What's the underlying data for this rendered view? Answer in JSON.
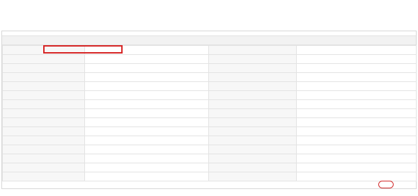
{
  "page": {
    "title": ""
  },
  "serial": {
    "text": ""
  },
  "form": {
    "rows": [
      {
        "left_label": "",
        "left_value": "",
        "right_label": "",
        "right_value": ""
      },
      {
        "left_label": "",
        "left_value": "",
        "right_label": "",
        "right_value": ""
      },
      {
        "left_label": "",
        "left_value": "",
        "right_label": "",
        "right_value": ""
      },
      {
        "left_label": "",
        "left_value": "",
        "right_label": "",
        "right_value": ""
      },
      {
        "left_label": "",
        "left_value": "",
        "right_label": "",
        "right_value": ""
      },
      {
        "left_label": "",
        "left_value": "",
        "right_label": "",
        "right_value": ""
      },
      {
        "left_label": "",
        "left_value": "",
        "right_label": "",
        "right_value": ""
      },
      {
        "left_label": "",
        "left_value": "",
        "right_label": "",
        "right_value": ""
      },
      {
        "left_label": "",
        "left_value": "",
        "right_label": "",
        "right_value": ""
      },
      {
        "left_label": "",
        "left_value": "",
        "right_label": "",
        "right_value": ""
      },
      {
        "left_label": "",
        "left_value": "",
        "right_label": "",
        "right_value": ""
      },
      {
        "left_label": "",
        "left_value": "",
        "right_label": "",
        "right_value": ""
      },
      {
        "left_label": "",
        "left_value": "",
        "right_label": "",
        "right_value": ""
      },
      {
        "left_label": "",
        "left_value": "",
        "right_label": "",
        "right_value": ""
      },
      {
        "left_label": "",
        "left_value": "",
        "right_label": "",
        "right_value": ""
      }
    ]
  },
  "brand": {
    "logo_text": "",
    "name": ""
  },
  "colors": {
    "highlight": "#d62424",
    "brand": "#d22a2a"
  }
}
